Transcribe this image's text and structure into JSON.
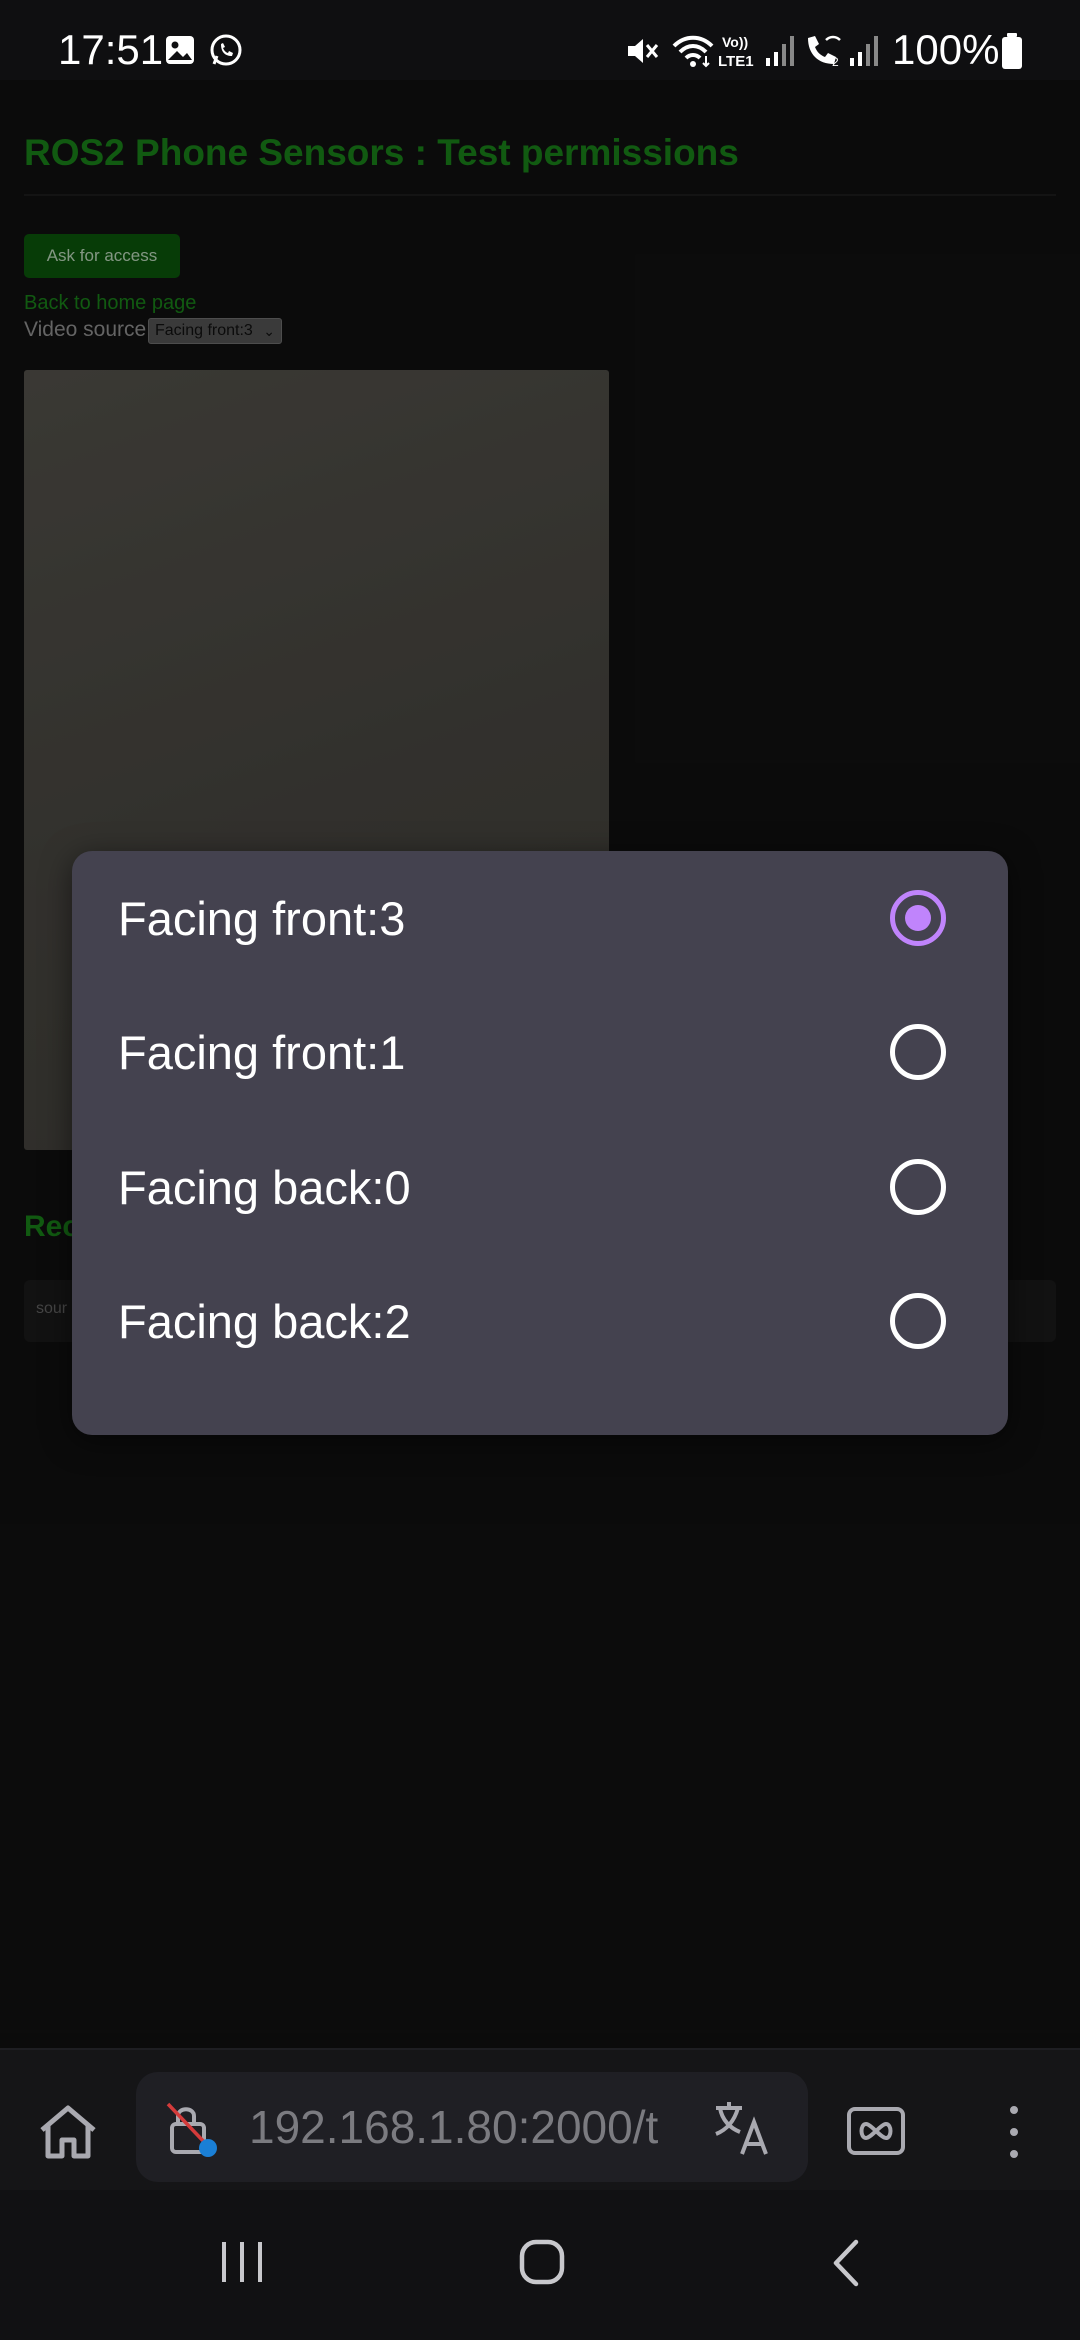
{
  "status_bar": {
    "time": "17:51",
    "battery_percent": "100%",
    "icons": [
      "gallery-icon",
      "whatsapp-icon",
      "mute-icon",
      "wifi-icon",
      "volte-icon",
      "signal-icon",
      "wifi-calling-icon",
      "signal-2-icon",
      "battery-icon"
    ],
    "volte_label": "Vo)) LTE1"
  },
  "page": {
    "title": "ROS2 Phone Sensors : Test permissions",
    "ask_button": "Ask for access",
    "back_link": "Back to home page",
    "video_source_label": "Video source:",
    "video_source_value": "Facing front:3",
    "rec_heading_partial": "Rec",
    "source_partial": "sour"
  },
  "dialog": {
    "selected_index": 0,
    "options": [
      {
        "label": "Facing front:3",
        "selected": true
      },
      {
        "label": "Facing front:1",
        "selected": false
      },
      {
        "label": "Facing back:0",
        "selected": false
      },
      {
        "label": "Facing back:2",
        "selected": false
      }
    ],
    "accent_color": "#c084fc"
  },
  "browser": {
    "url": "192.168.1.80:2000/t",
    "icons": [
      "home-icon",
      "insecure-lock-icon",
      "translate-icon",
      "tabs-icon",
      "more-icon"
    ]
  },
  "nav": {
    "icons": [
      "recents-icon",
      "home-nav-icon",
      "back-icon"
    ]
  }
}
